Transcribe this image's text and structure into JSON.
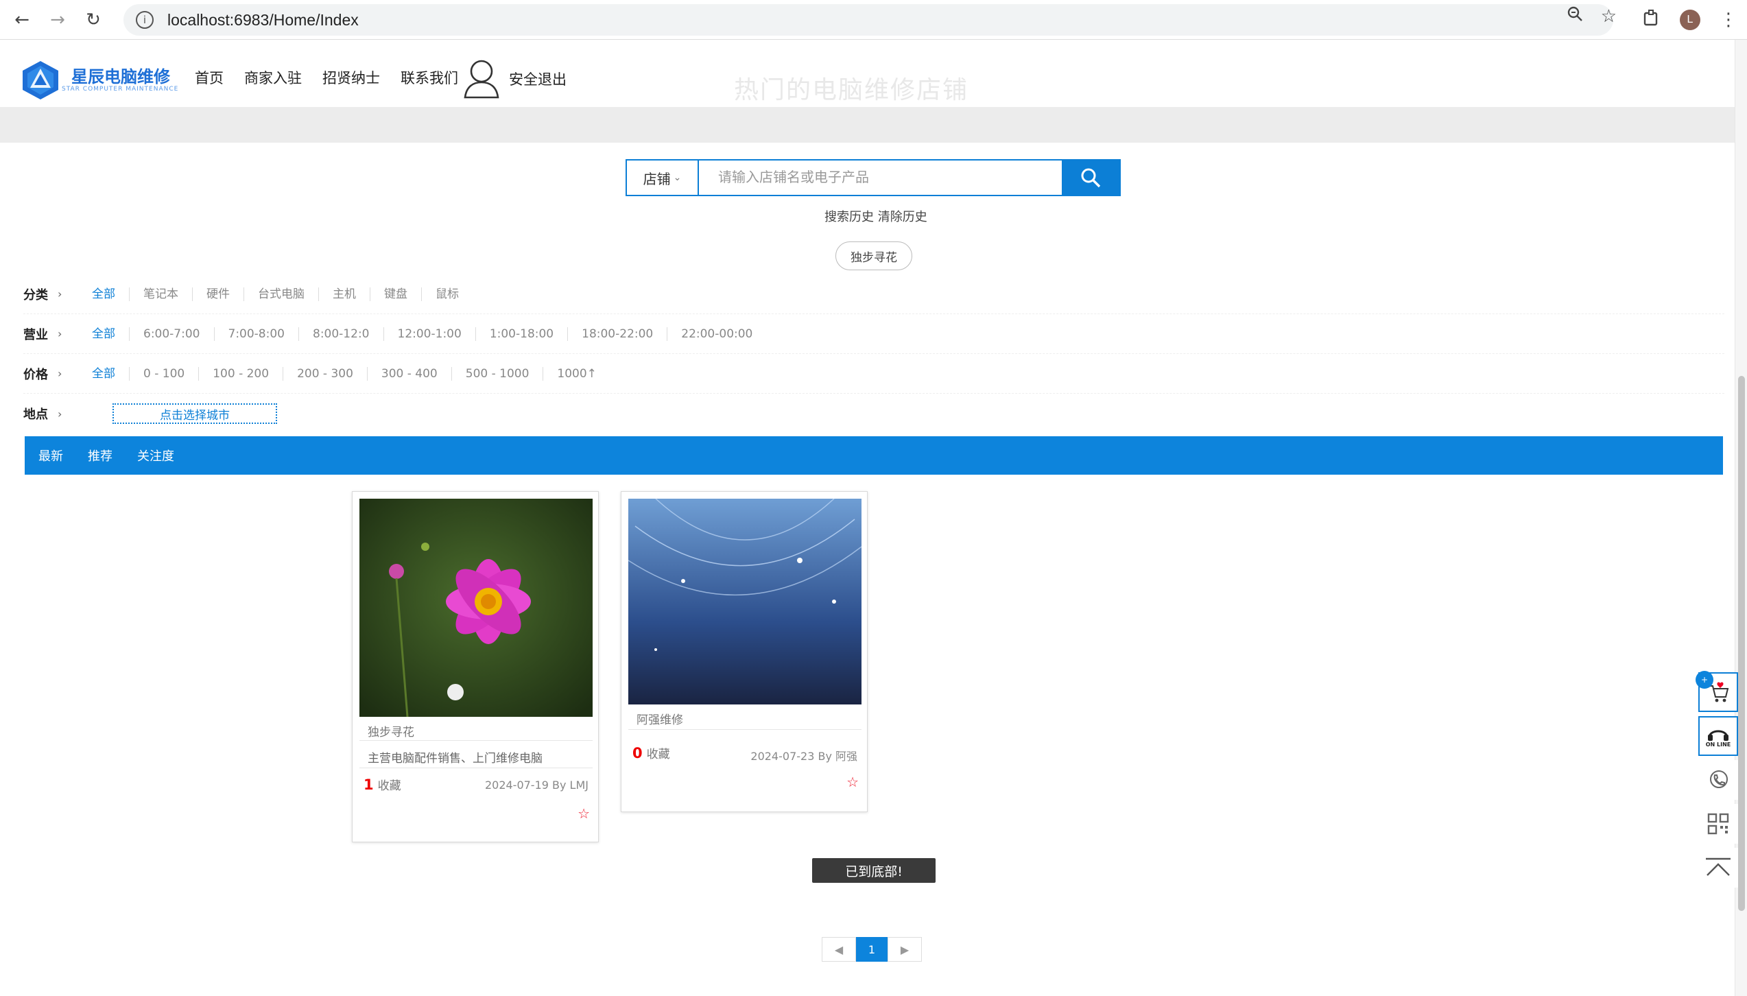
{
  "browser": {
    "url": "localhost:6983/Home/Index",
    "avatar_letter": "L"
  },
  "header": {
    "logo_text": "星辰电脑维修",
    "logo_sub": "STAR COMPUTER MAINTENANCE",
    "nav": [
      "首页",
      "商家入驻",
      "招贤纳士",
      "联系我们"
    ],
    "logout": "安全退出",
    "ghost_title": "热门的电脑维修店铺"
  },
  "search": {
    "type_label": "店铺",
    "placeholder": "请输入店铺名或电子产品",
    "history": "搜索历史 清除历史",
    "hot_tag": "独步寻花"
  },
  "filters": {
    "category": {
      "label": "分类",
      "options": [
        "全部",
        "笔记本",
        "硬件",
        "台式电脑",
        "主机",
        "键盘",
        "鼠标"
      ]
    },
    "hours": {
      "label": "营业",
      "options": [
        "全部",
        "6:00-7:00",
        "7:00-8:00",
        "8:00-12:0",
        "12:00-1:00",
        "1:00-18:00",
        "18:00-22:00",
        "22:00-00:00"
      ]
    },
    "price": {
      "label": "价格",
      "options": [
        "全部",
        "0 - 100",
        "100 - 200",
        "200 - 300",
        "300 - 400",
        "500 - 1000",
        "1000↑"
      ]
    },
    "location": {
      "label": "地点",
      "button": "点击选择城市"
    }
  },
  "sort_tabs": [
    "最新",
    "推荐",
    "关注度"
  ],
  "shops": [
    {
      "name": "独步寻花",
      "desc": "主营电脑配件销售、上门维修电脑",
      "fav_count": "1",
      "fav_label": "收藏",
      "date_by": "2024-07-19 By LMJ"
    },
    {
      "name": "阿强维修",
      "desc": "",
      "fav_count": "0",
      "fav_label": "收藏",
      "date_by": "2024-07-23 By 阿强"
    }
  ],
  "bottom_msg": "已到底部!",
  "pager": {
    "prev": "◀",
    "current": "1",
    "next": "▶"
  },
  "side": {
    "online_label": "ON LINE"
  },
  "colors": {
    "accent": "#0d84dc",
    "favorite": "#e00000"
  }
}
